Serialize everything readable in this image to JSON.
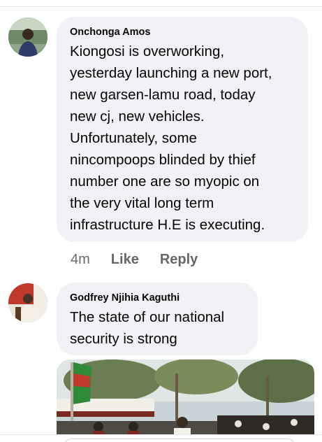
{
  "comments": [
    {
      "author": "Onchonga Amos",
      "text": "Kiongosi is overworking,\nyesterday launching a new port,\nnew garsen-lamu road, today\nnew cj, new vehicles.\nUnfortunately, some\nnincompoops blinded by thief\nnumber one are so myopic on\nthe very vital long term\ninfrastructure H.E is executing.",
      "time": "4m",
      "like_label": "Like",
      "reply_label": "Reply"
    },
    {
      "author": "Godfrey Njihia Kaguthi",
      "text": "The state of our national\nsecurity is strong"
    }
  ],
  "colors": {
    "bubble": "#f0f2f5",
    "text": "#050505",
    "secondary": "#65676b"
  }
}
